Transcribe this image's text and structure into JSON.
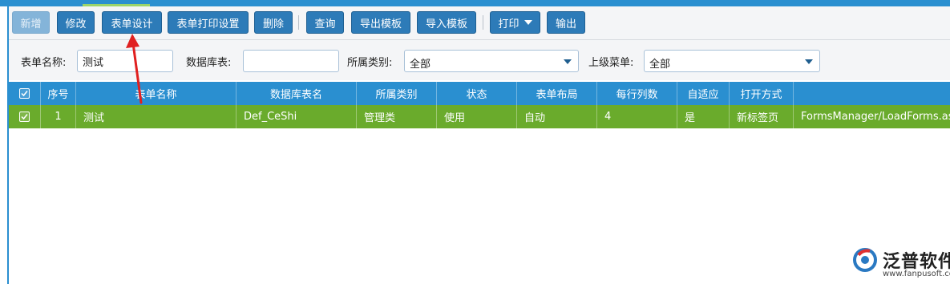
{
  "toolbar": {
    "buttons": [
      {
        "label": "新增",
        "disabled": true
      },
      {
        "label": "修改"
      },
      {
        "label": "表单设计"
      },
      {
        "label": "表单打印设置"
      },
      {
        "label": "删除"
      },
      {
        "label": "查询"
      },
      {
        "label": "导出模板"
      },
      {
        "label": "导入模板"
      },
      {
        "label": "打印"
      },
      {
        "label": "输出"
      }
    ]
  },
  "filters": {
    "form_name_label": "表单名称:",
    "form_name_value": "测试",
    "db_table_label": "数据库表:",
    "db_table_value": "",
    "category_label": "所属类别:",
    "category_value": "全部",
    "parent_menu_label": "上级菜单:",
    "parent_menu_value": "全部"
  },
  "table": {
    "columns": [
      "序号",
      "表单名称",
      "数据库表名",
      "所属类别",
      "状态",
      "表单布局",
      "每行列数",
      "自适应",
      "打开方式",
      ""
    ],
    "rows": [
      [
        "1",
        "测试",
        "Def_CeShi",
        "管理类",
        "使用",
        "自动",
        "4",
        "是",
        "新标签页",
        "FormsManager/LoadForms.aspx"
      ]
    ]
  },
  "logo": {
    "name": "泛普软件",
    "url": "www.fanpusoft.com"
  },
  "colors": {
    "topbar": "#2a8fd0",
    "button": "#2d7bb8",
    "header": "#2a8fd0",
    "selected_row": "#6aab2c",
    "annotation_arrow": "#e02020"
  }
}
